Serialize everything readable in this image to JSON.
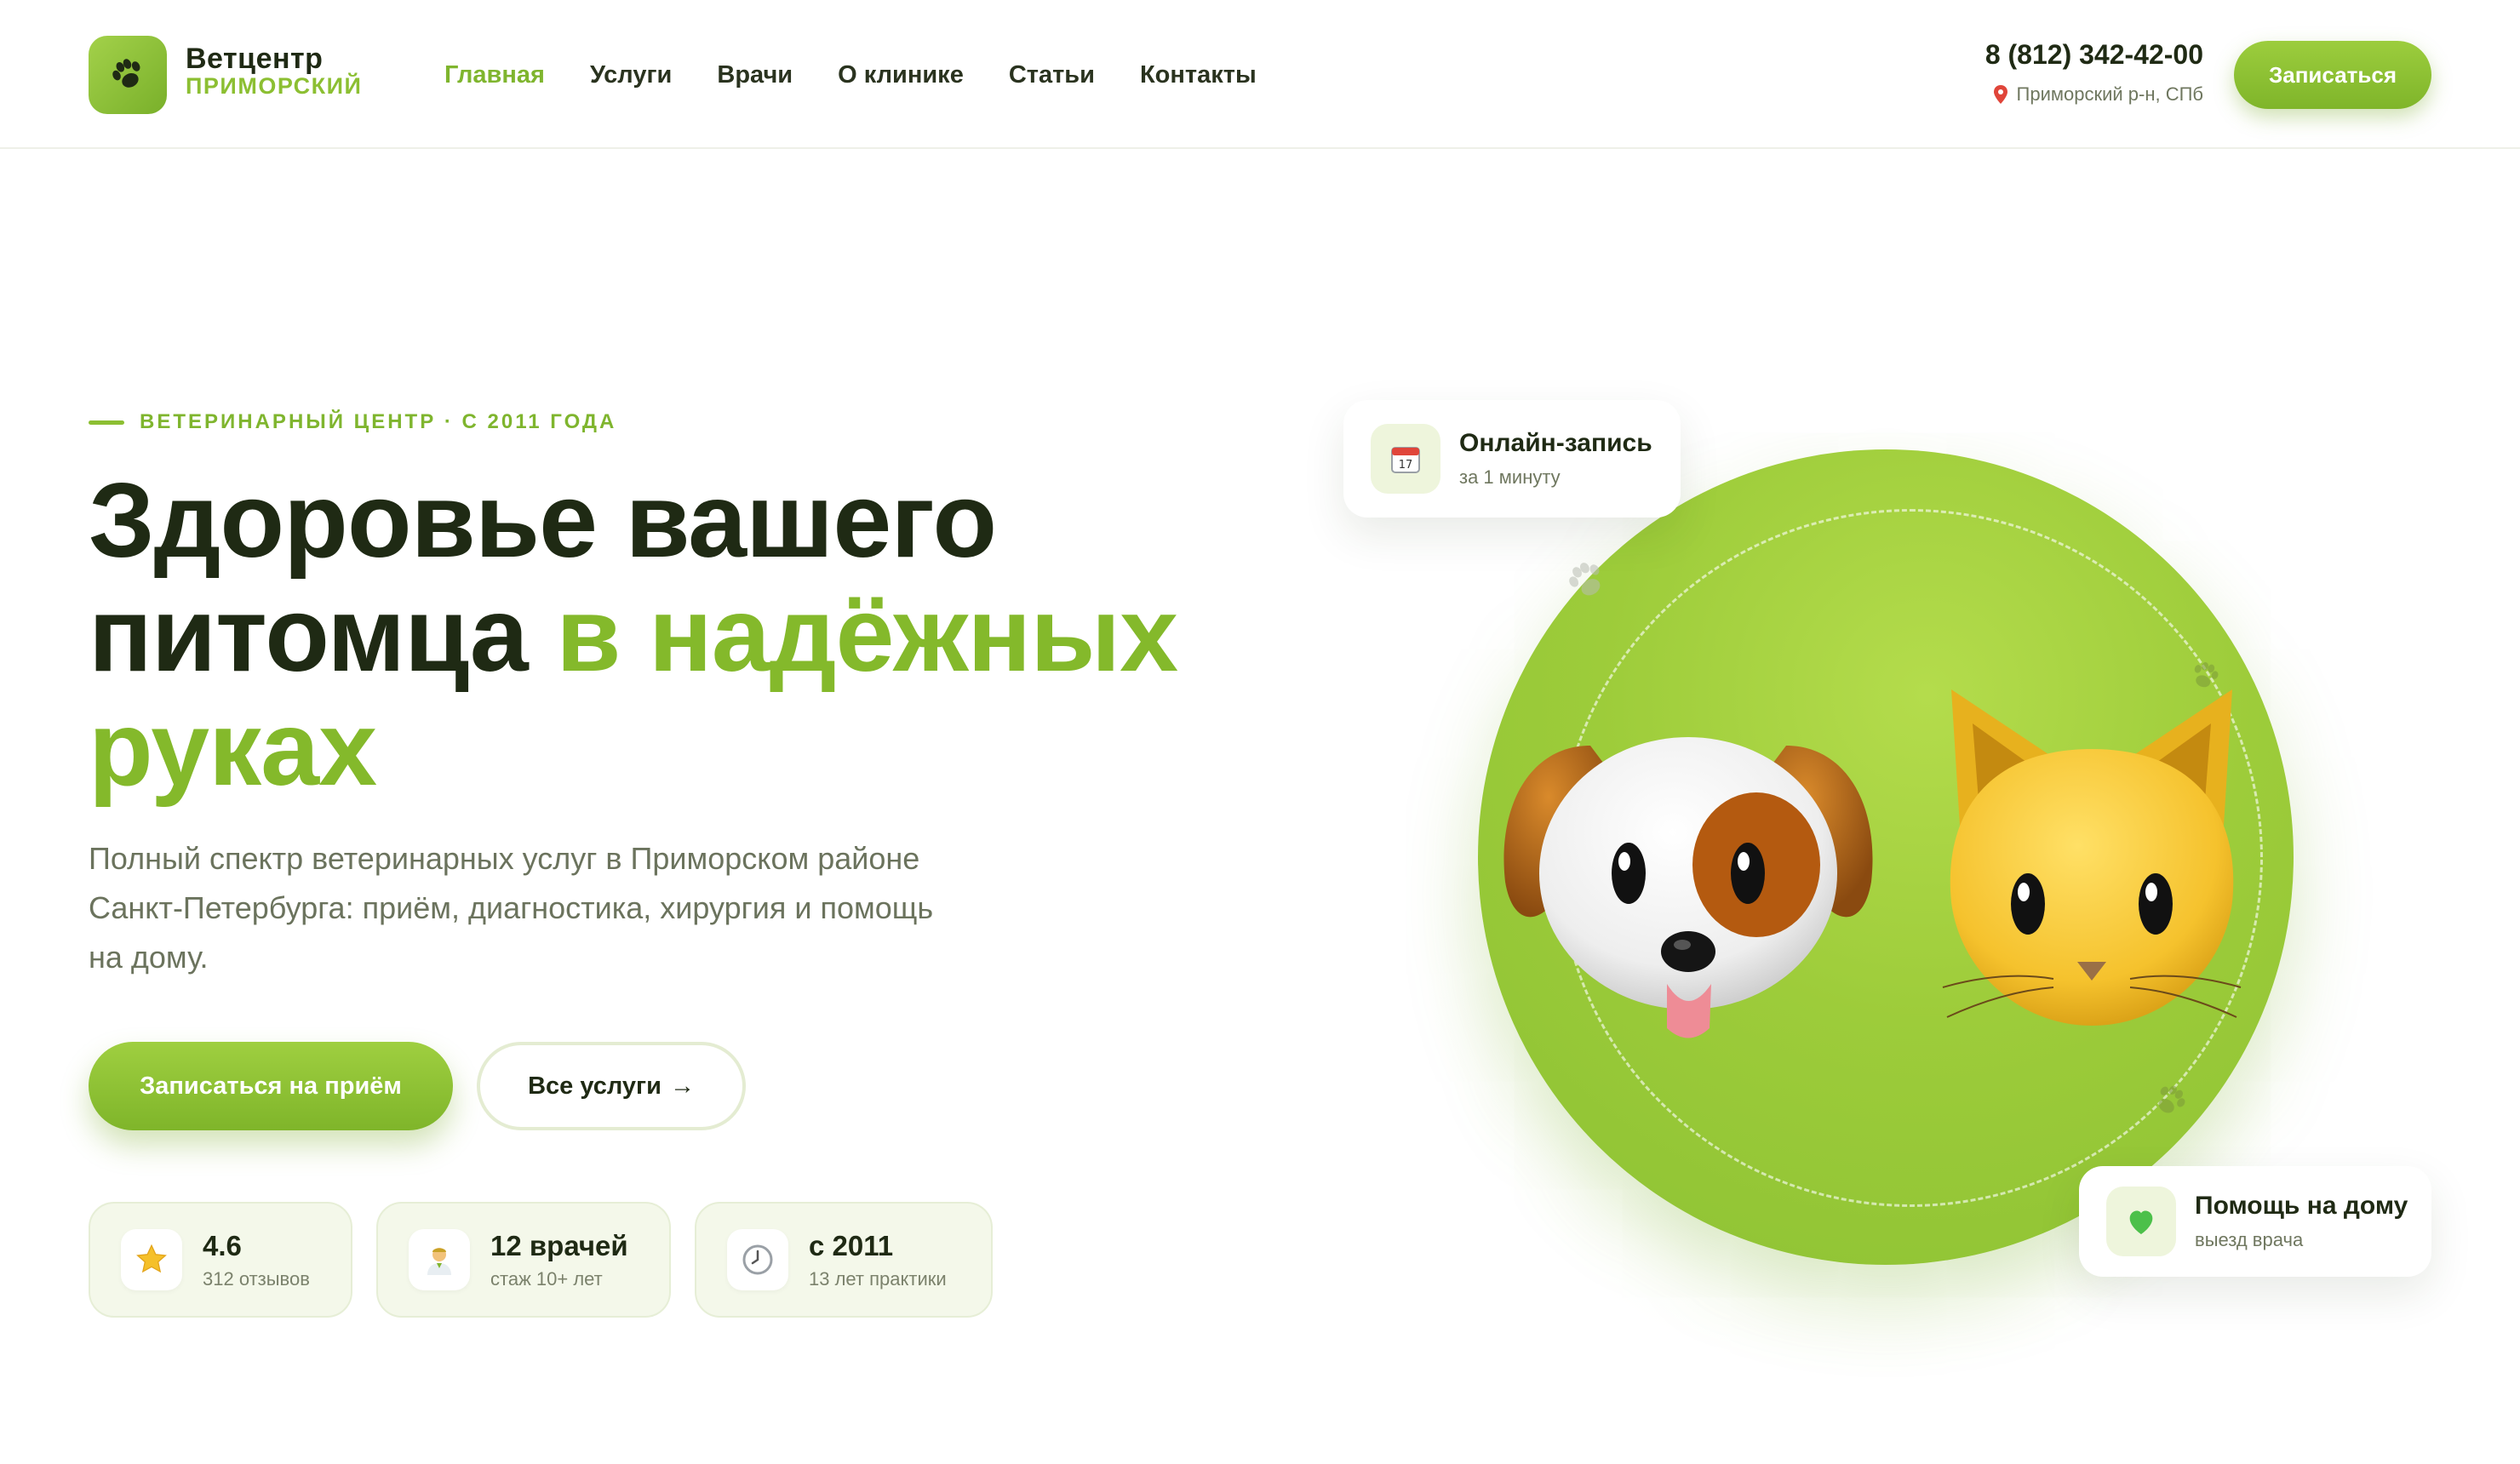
{
  "brand": {
    "name": "Ветцентр",
    "subtitle": "ПРИМОРСКИЙ",
    "accent_color": "#8cbf32"
  },
  "nav": {
    "items": [
      {
        "label": "Главная",
        "active": true
      },
      {
        "label": "Услуги",
        "active": false
      },
      {
        "label": "Врачи",
        "active": false
      },
      {
        "label": "О клинике",
        "active": false
      },
      {
        "label": "Статьи",
        "active": false
      },
      {
        "label": "Контакты",
        "active": false
      }
    ]
  },
  "contact": {
    "phone": "8 (812) 342-42-00",
    "address": "Приморский р-н, СПб",
    "cta_label": "Записаться"
  },
  "hero": {
    "eyebrow": "ВЕТЕРИНАРНЫЙ ЦЕНТР · С 2011 ГОДА",
    "headline_part1": "Здоровье вашего питомца ",
    "headline_accent": "в надёжных руках",
    "lead": "Полный спектр ветеринарных услуг в Приморском районе Санкт-Петербурга: приём, диагностика, хирургия и помощь на дому.",
    "primary_button": "Записаться на приём",
    "secondary_button": "Все услуги",
    "secondary_arrow": "→"
  },
  "stats": [
    {
      "icon": "star-icon",
      "value": "4.6",
      "label": "312 отзывов"
    },
    {
      "icon": "doctor-icon",
      "value": "12 врачей",
      "label": "стаж 10+ лет"
    },
    {
      "icon": "clock-icon",
      "value": "с 2011",
      "label": "13 лет практики"
    }
  ],
  "cards": {
    "online": {
      "icon": "calendar-icon",
      "title": "Онлайн-запись",
      "subtitle": "за 1 минуту"
    },
    "home": {
      "icon": "green-heart-icon",
      "title": "Помощь на дому",
      "subtitle": "выезд врача"
    }
  },
  "illustration": {
    "animals": [
      "dog-emoji",
      "cat-emoji"
    ],
    "circle_color": "#9dcc3a"
  }
}
